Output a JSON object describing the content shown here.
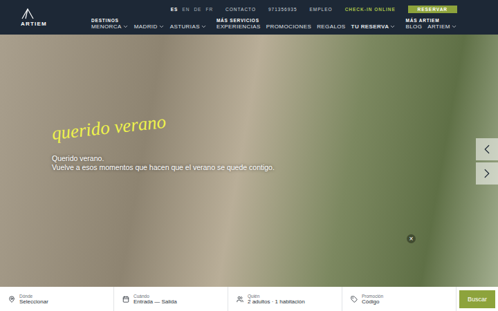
{
  "brand": {
    "name": "ARTIEM"
  },
  "languages": [
    {
      "label": "ES",
      "selected": true
    },
    {
      "label": "EN",
      "selected": false
    },
    {
      "label": "DE",
      "selected": false
    },
    {
      "label": "FR",
      "selected": false
    }
  ],
  "top_links": [
    "CONTACTO",
    "971356935",
    "EMPLEO"
  ],
  "checkin": "CHECK-IN ONLINE",
  "reserve_button": "RESERVAR",
  "nav_groups": [
    {
      "title": "DESTINOS",
      "items": [
        {
          "label": "MENORCA",
          "dropdown": true,
          "bold": false
        },
        {
          "label": "MADRID",
          "dropdown": true,
          "bold": false
        },
        {
          "label": "ASTURIAS",
          "dropdown": true,
          "bold": false
        }
      ]
    },
    {
      "title": "MÁS SERVICIOS",
      "items": [
        {
          "label": "EXPERIENCIAS",
          "dropdown": false,
          "bold": false
        },
        {
          "label": "PROMOCIONES",
          "dropdown": false,
          "bold": false
        },
        {
          "label": "REGALOS",
          "dropdown": false,
          "bold": false
        },
        {
          "label": "TU RESERVA",
          "dropdown": true,
          "bold": true
        }
      ]
    },
    {
      "title": "MÁS ARTIEM",
      "items": [
        {
          "label": "BLOG",
          "dropdown": false,
          "bold": false
        },
        {
          "label": "ARTIEM",
          "dropdown": true,
          "bold": false
        }
      ]
    }
  ],
  "hero": {
    "script": "querido verano",
    "title": "Querido verano.",
    "subtitle": "Vuelve a esos momentos que hacen que el verano se quede contigo.",
    "close": "×"
  },
  "search": {
    "fields": [
      {
        "kind": "place",
        "label": "Dónde",
        "value": "Seleccionar"
      },
      {
        "kind": "dates",
        "label": "Cuándo",
        "value": "Entrada — Salida"
      },
      {
        "kind": "guests",
        "label": "Quién",
        "value": "2 adultos · 1 habitación"
      },
      {
        "kind": "promo",
        "label": "Promoción",
        "value": "Código"
      }
    ],
    "button": "Buscar"
  }
}
